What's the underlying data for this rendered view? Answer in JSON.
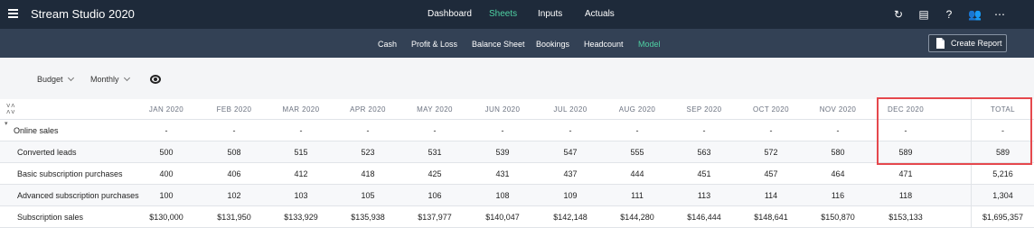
{
  "app": {
    "title": "Stream Studio 2020"
  },
  "top_tabs": [
    {
      "label": "Dashboard",
      "active": false
    },
    {
      "label": "Sheets",
      "active": true
    },
    {
      "label": "Inputs",
      "active": false
    },
    {
      "label": "Actuals",
      "active": false
    }
  ],
  "top_icons": [
    "refresh-icon",
    "document-icon",
    "help-icon",
    "people-icon",
    "more-icon"
  ],
  "sub_tabs": [
    {
      "label": "Cash",
      "active": false
    },
    {
      "label": "Profit & Loss",
      "active": false
    },
    {
      "label": "Balance Sheet",
      "active": false
    },
    {
      "label": "Bookings",
      "active": false
    },
    {
      "label": "Headcount",
      "active": false
    },
    {
      "label": "Model",
      "active": true
    }
  ],
  "actions": {
    "create_report": "Create Report"
  },
  "filters": {
    "scenario": "Budget",
    "period": "Monthly"
  },
  "table": {
    "columns": [
      "JAN 2020",
      "FEB 2020",
      "MAR 2020",
      "APR 2020",
      "MAY 2020",
      "JUN 2020",
      "JUL 2020",
      "AUG 2020",
      "SEP 2020",
      "OCT 2020",
      "NOV 2020",
      "DEC 2020",
      "TOTAL"
    ],
    "rows": [
      {
        "label": "Online sales",
        "values": [
          "-",
          "-",
          "-",
          "-",
          "-",
          "-",
          "-",
          "-",
          "-",
          "-",
          "-",
          "-",
          "-"
        ]
      },
      {
        "label": "Converted leads",
        "values": [
          "500",
          "508",
          "515",
          "523",
          "531",
          "539",
          "547",
          "555",
          "563",
          "572",
          "580",
          "589",
          "589"
        ]
      },
      {
        "label": "Basic subscription purchases",
        "values": [
          "400",
          "406",
          "412",
          "418",
          "425",
          "431",
          "437",
          "444",
          "451",
          "457",
          "464",
          "471",
          "5,216"
        ]
      },
      {
        "label": "Advanced subscription purchases",
        "values": [
          "100",
          "102",
          "103",
          "105",
          "106",
          "108",
          "109",
          "111",
          "113",
          "114",
          "116",
          "118",
          "1,304"
        ]
      },
      {
        "label": "Subscription sales",
        "values": [
          "$130,000",
          "$131,950",
          "$133,929",
          "$135,938",
          "$137,977",
          "$140,047",
          "$142,148",
          "$144,280",
          "$146,444",
          "$148,641",
          "$150,870",
          "$153,133",
          "$1,695,357"
        ]
      }
    ]
  },
  "colors": {
    "topbar": "#1e2a3a",
    "subbar": "#334155",
    "active_tab": "#4fd1a3",
    "highlight": "#e5484d"
  }
}
